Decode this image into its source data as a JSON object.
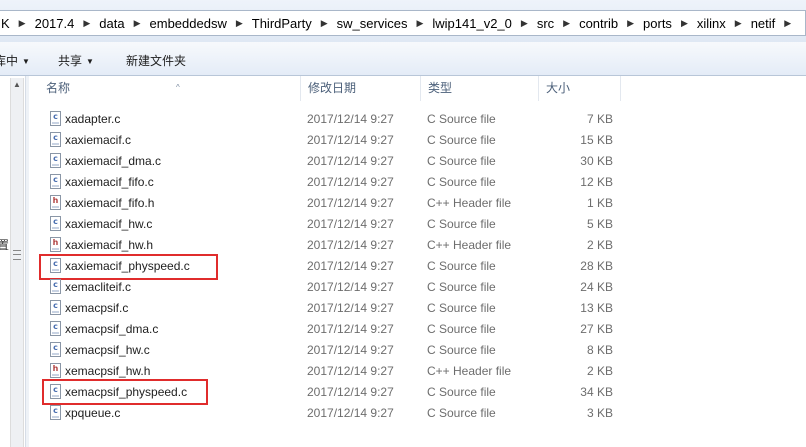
{
  "address": {
    "crumbs": [
      "K",
      "2017.4",
      "data",
      "embeddedsw",
      "ThirdParty",
      "sw_services",
      "lwip141_v2_0",
      "src",
      "contrib",
      "ports",
      "xilinx",
      "netif"
    ],
    "separator": "▶"
  },
  "toolbar": {
    "left_cut": "库中",
    "share": "共享",
    "new_folder": "新建文件夹",
    "dropdown_glyph": "▼"
  },
  "columns": {
    "name": "名称",
    "date": "修改日期",
    "type": "类型",
    "size": "大小"
  },
  "files": [
    {
      "name": "xadapter.c",
      "date": "2017/12/14 9:27",
      "type": "C Source file",
      "size": "7 KB",
      "icon": "c"
    },
    {
      "name": "xaxiemacif.c",
      "date": "2017/12/14 9:27",
      "type": "C Source file",
      "size": "15 KB",
      "icon": "c"
    },
    {
      "name": "xaxiemacif_dma.c",
      "date": "2017/12/14 9:27",
      "type": "C Source file",
      "size": "30 KB",
      "icon": "c"
    },
    {
      "name": "xaxiemacif_fifo.c",
      "date": "2017/12/14 9:27",
      "type": "C Source file",
      "size": "12 KB",
      "icon": "c"
    },
    {
      "name": "xaxiemacif_fifo.h",
      "date": "2017/12/14 9:27",
      "type": "C++ Header file",
      "size": "1 KB",
      "icon": "h"
    },
    {
      "name": "xaxiemacif_hw.c",
      "date": "2017/12/14 9:27",
      "type": "C Source file",
      "size": "5 KB",
      "icon": "c"
    },
    {
      "name": "xaxiemacif_hw.h",
      "date": "2017/12/14 9:27",
      "type": "C++ Header file",
      "size": "2 KB",
      "icon": "h"
    },
    {
      "name": "xaxiemacif_physpeed.c",
      "date": "2017/12/14 9:27",
      "type": "C Source file",
      "size": "28 KB",
      "icon": "c",
      "highlighted": true
    },
    {
      "name": "xemacliteif.c",
      "date": "2017/12/14 9:27",
      "type": "C Source file",
      "size": "24 KB",
      "icon": "c"
    },
    {
      "name": "xemacpsif.c",
      "date": "2017/12/14 9:27",
      "type": "C Source file",
      "size": "13 KB",
      "icon": "c"
    },
    {
      "name": "xemacpsif_dma.c",
      "date": "2017/12/14 9:27",
      "type": "C Source file",
      "size": "27 KB",
      "icon": "c"
    },
    {
      "name": "xemacpsif_hw.c",
      "date": "2017/12/14 9:27",
      "type": "C Source file",
      "size": "8 KB",
      "icon": "c"
    },
    {
      "name": "xemacpsif_hw.h",
      "date": "2017/12/14 9:27",
      "type": "C++ Header file",
      "size": "2 KB",
      "icon": "h"
    },
    {
      "name": "xemacpsif_physpeed.c",
      "date": "2017/12/14 9:27",
      "type": "C Source file",
      "size": "34 KB",
      "icon": "c",
      "highlighted": true
    },
    {
      "name": "xpqueue.c",
      "date": "2017/12/14 9:27",
      "type": "C Source file",
      "size": "3 KB",
      "icon": "c"
    }
  ],
  "icon_letters": {
    "c": "c",
    "h": "h"
  },
  "nav": {
    "label_cut": "置"
  },
  "colors": {
    "highlight": "#e02c2c",
    "header_text": "#4c607a",
    "meta_text": "#6d6d6d"
  }
}
